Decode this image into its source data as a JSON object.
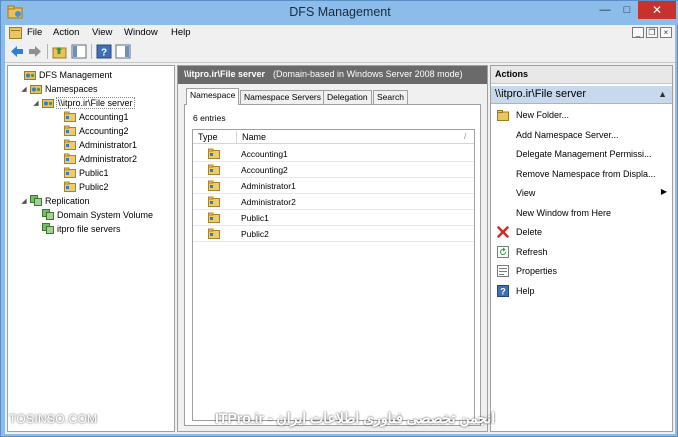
{
  "window": {
    "title": "DFS Management"
  },
  "menu": [
    "File",
    "Action",
    "View",
    "Window",
    "Help"
  ],
  "tree": [
    {
      "label": "DFS Management",
      "icon": "dfs-management-icon",
      "expander": "",
      "level": 0
    },
    {
      "label": "Namespaces",
      "icon": "namespaces-icon",
      "expander": "◢",
      "level": 1
    },
    {
      "label": "\\\\itpro.ir\\File server",
      "icon": "namespace-root-icon",
      "expander": "◢",
      "level": 2,
      "selected": true
    },
    {
      "label": "Accounting1",
      "icon": "folder-target-icon",
      "expander": "",
      "level": 3
    },
    {
      "label": "Accounting2",
      "icon": "folder-target-icon",
      "expander": "",
      "level": 3
    },
    {
      "label": "Administrator1",
      "icon": "folder-target-icon",
      "expander": "",
      "level": 3
    },
    {
      "label": "Administrator2",
      "icon": "folder-target-icon",
      "expander": "",
      "level": 3
    },
    {
      "label": "Public1",
      "icon": "folder-target-icon",
      "expander": "",
      "level": 3
    },
    {
      "label": "Public2",
      "icon": "folder-target-icon",
      "expander": "",
      "level": 3
    },
    {
      "label": "Replication",
      "icon": "replication-icon",
      "expander": "◢",
      "level": 1
    },
    {
      "label": "Domain System Volume",
      "icon": "replication-group-icon",
      "expander": "",
      "level": 2
    },
    {
      "label": "itpro file servers",
      "icon": "replication-group-icon",
      "expander": "",
      "level": 2
    }
  ],
  "center": {
    "path": "\\\\itpro.ir\\File server",
    "description": "(Domain-based in Windows Server 2008 mode)",
    "tabs": [
      "Namespace",
      "Namespace Servers",
      "Delegation",
      "Search"
    ],
    "entries": "6 entries",
    "columns": {
      "type": "Type",
      "name": "Name",
      "sort": "/"
    },
    "rows": [
      "Accounting1",
      "Accounting2",
      "Administrator1",
      "Administrator2",
      "Public1",
      "Public2"
    ]
  },
  "actions": {
    "title": "Actions",
    "section": "\\\\itpro.ir\\File server",
    "caret": "▲",
    "items": [
      {
        "label": "New Folder...",
        "icon": "new-folder-icon"
      },
      {
        "label": "Add Namespace Server...",
        "icon": ""
      },
      {
        "label": "Delegate Management Permissi...",
        "icon": ""
      },
      {
        "label": "Remove Namespace from Displa...",
        "icon": ""
      },
      {
        "label": "View",
        "icon": "",
        "arrow": "▶"
      },
      {
        "label": "New Window from Here",
        "icon": ""
      },
      {
        "label": "Delete",
        "icon": "delete-icon"
      },
      {
        "label": "Refresh",
        "icon": "refresh-icon"
      },
      {
        "label": "Properties",
        "icon": "properties-icon"
      },
      {
        "label": "Help",
        "icon": "help-icon"
      }
    ]
  },
  "watermark": {
    "left": "TOSINSO.COM",
    "center": "انجمن تخصصی فناوری اطلاعات ایران - ITPro.ir"
  },
  "colors": {
    "titlebar": "#8cbcea",
    "close": "#c7332c",
    "header": "#6a6a6a",
    "section": "#c8d9ee"
  }
}
